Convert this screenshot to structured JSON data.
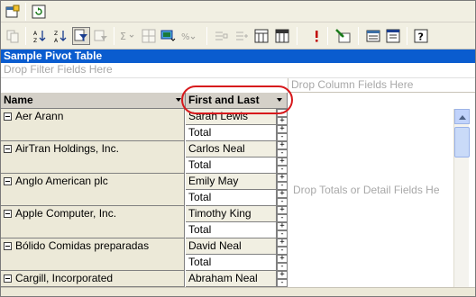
{
  "toolbar_primary": {
    "icons": [
      "field-list-icon",
      "refresh-icon"
    ]
  },
  "toolbar_secondary": {
    "icons": [
      "copy-icon",
      "sort-ascending-icon",
      "sort-descending-icon",
      "autofilter-icon",
      "show-top-bottom-icon",
      "autocalc-icon",
      "subtotal-icon",
      "calculated-total-icon",
      "percent-icon",
      "collapse-icon",
      "expand-icon",
      "hide-details-icon",
      "show-details-icon",
      "error-icon",
      "export-excel-icon",
      "field-list-icon",
      "properties-icon",
      "help-icon"
    ]
  },
  "pivot": {
    "title": "Sample Pivot Table",
    "filter_drop": "Drop Filter Fields Here",
    "column_drop": "Drop Column Fields Here",
    "data_drop": "Drop Totals or Detail Fields He",
    "row_header": "Name",
    "col_header": "First and Last",
    "highlight_color": "#d7191c",
    "title_color": "#0a5ccf",
    "rows": [
      {
        "label": "Aer Arann",
        "first_last": "Sarah Lewis",
        "total": "Total"
      },
      {
        "label": "AirTran Holdings, Inc.",
        "first_last": "Carlos Neal",
        "total": "Total"
      },
      {
        "label": "Anglo American plc",
        "first_last": "Emily May",
        "total": "Total"
      },
      {
        "label": "Apple Computer, Inc.",
        "first_last": "Timothy King",
        "total": "Total"
      },
      {
        "label": "Bólido Comidas preparadas",
        "first_last": "David Neal",
        "total": "Total"
      },
      {
        "label": "Cargill, Incorporated",
        "first_last": "Abraham Neal",
        "total": ""
      }
    ]
  }
}
